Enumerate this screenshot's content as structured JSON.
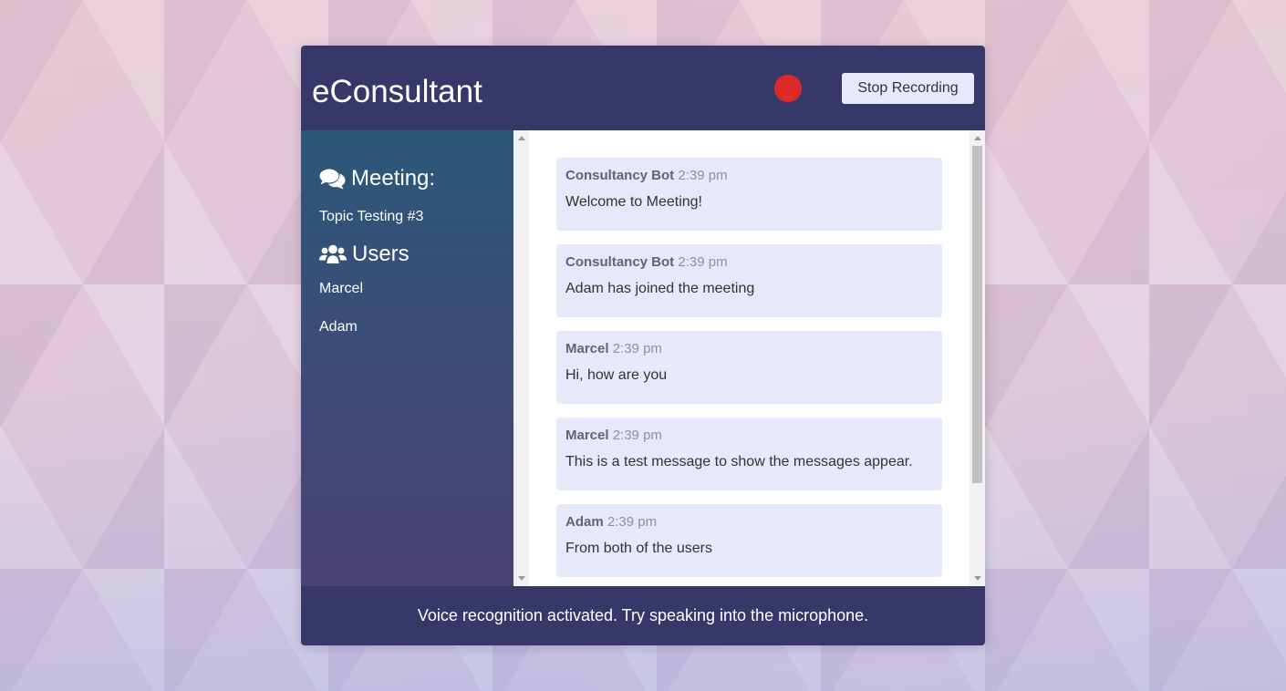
{
  "app": {
    "title": "eConsultant",
    "stop_button_label": "Stop Recording",
    "recording_indicator_color": "#db2a27",
    "header_color": "#373869"
  },
  "sidebar": {
    "meeting_heading": "Meeting:",
    "meeting_icon": "comments-icon",
    "topic": "Topic Testing #3",
    "users_heading": "Users",
    "users_icon": "users-icon",
    "users": [
      "Marcel",
      "Adam"
    ]
  },
  "messages": [
    {
      "author": "Consultancy Bot",
      "time": "2:39 pm",
      "text": "Welcome to Meeting!"
    },
    {
      "author": "Consultancy Bot",
      "time": "2:39 pm",
      "text": "Adam has joined the meeting"
    },
    {
      "author": "Marcel",
      "time": "2:39 pm",
      "text": "Hi, how are you"
    },
    {
      "author": "Marcel",
      "time": "2:39 pm",
      "text": "This is a test message to show the messages appear."
    },
    {
      "author": "Adam",
      "time": "2:39 pm",
      "text": "From both of the users"
    }
  ],
  "status": {
    "text": "Voice recognition activated. Try speaking into the microphone."
  }
}
